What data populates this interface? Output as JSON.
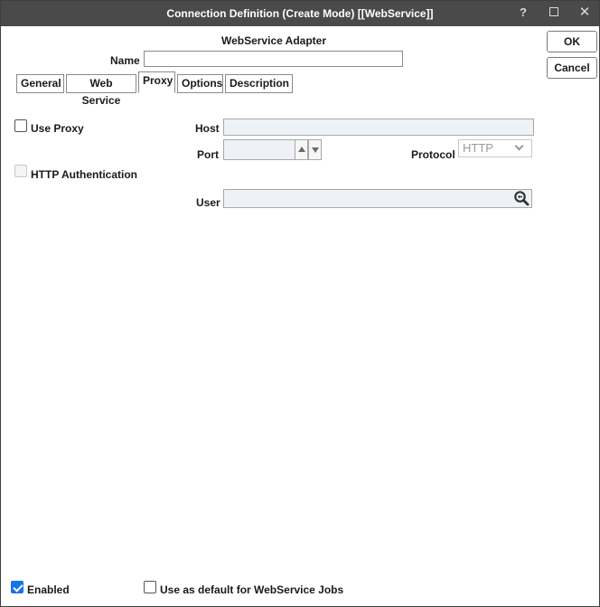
{
  "window": {
    "title": "Connection Definition (Create Mode) [[WebService]]",
    "help_glyph": "?",
    "close_glyph": "✕"
  },
  "actions": {
    "ok_label": "OK",
    "cancel_label": "Cancel"
  },
  "header": {
    "adapter_title": "WebService Adapter",
    "name_label": "Name",
    "name_value": ""
  },
  "tabs": [
    {
      "label": "General",
      "active": false
    },
    {
      "label": "Web Service",
      "active": false
    },
    {
      "label": "Proxy",
      "active": true
    },
    {
      "label": "Options",
      "active": false
    },
    {
      "label": "Description",
      "active": false
    }
  ],
  "proxy": {
    "use_proxy_label": "Use Proxy",
    "use_proxy_checked": false,
    "host_label": "Host",
    "host_value": "",
    "port_label": "Port",
    "port_value": "",
    "protocol_label": "Protocol",
    "protocol_value": "HTTP",
    "http_auth_label": "HTTP Authentication",
    "http_auth_checked": false,
    "user_label": "User",
    "user_value": ""
  },
  "footer": {
    "enabled_label": "Enabled",
    "enabled_checked": true,
    "default_label": "Use as default for WebService Jobs",
    "default_checked": false
  },
  "colors": {
    "titlebar_bg": "#4a4a4a",
    "checkbox_accent": "#1a73e8",
    "readonly_field_bg": "#eef1f5"
  }
}
